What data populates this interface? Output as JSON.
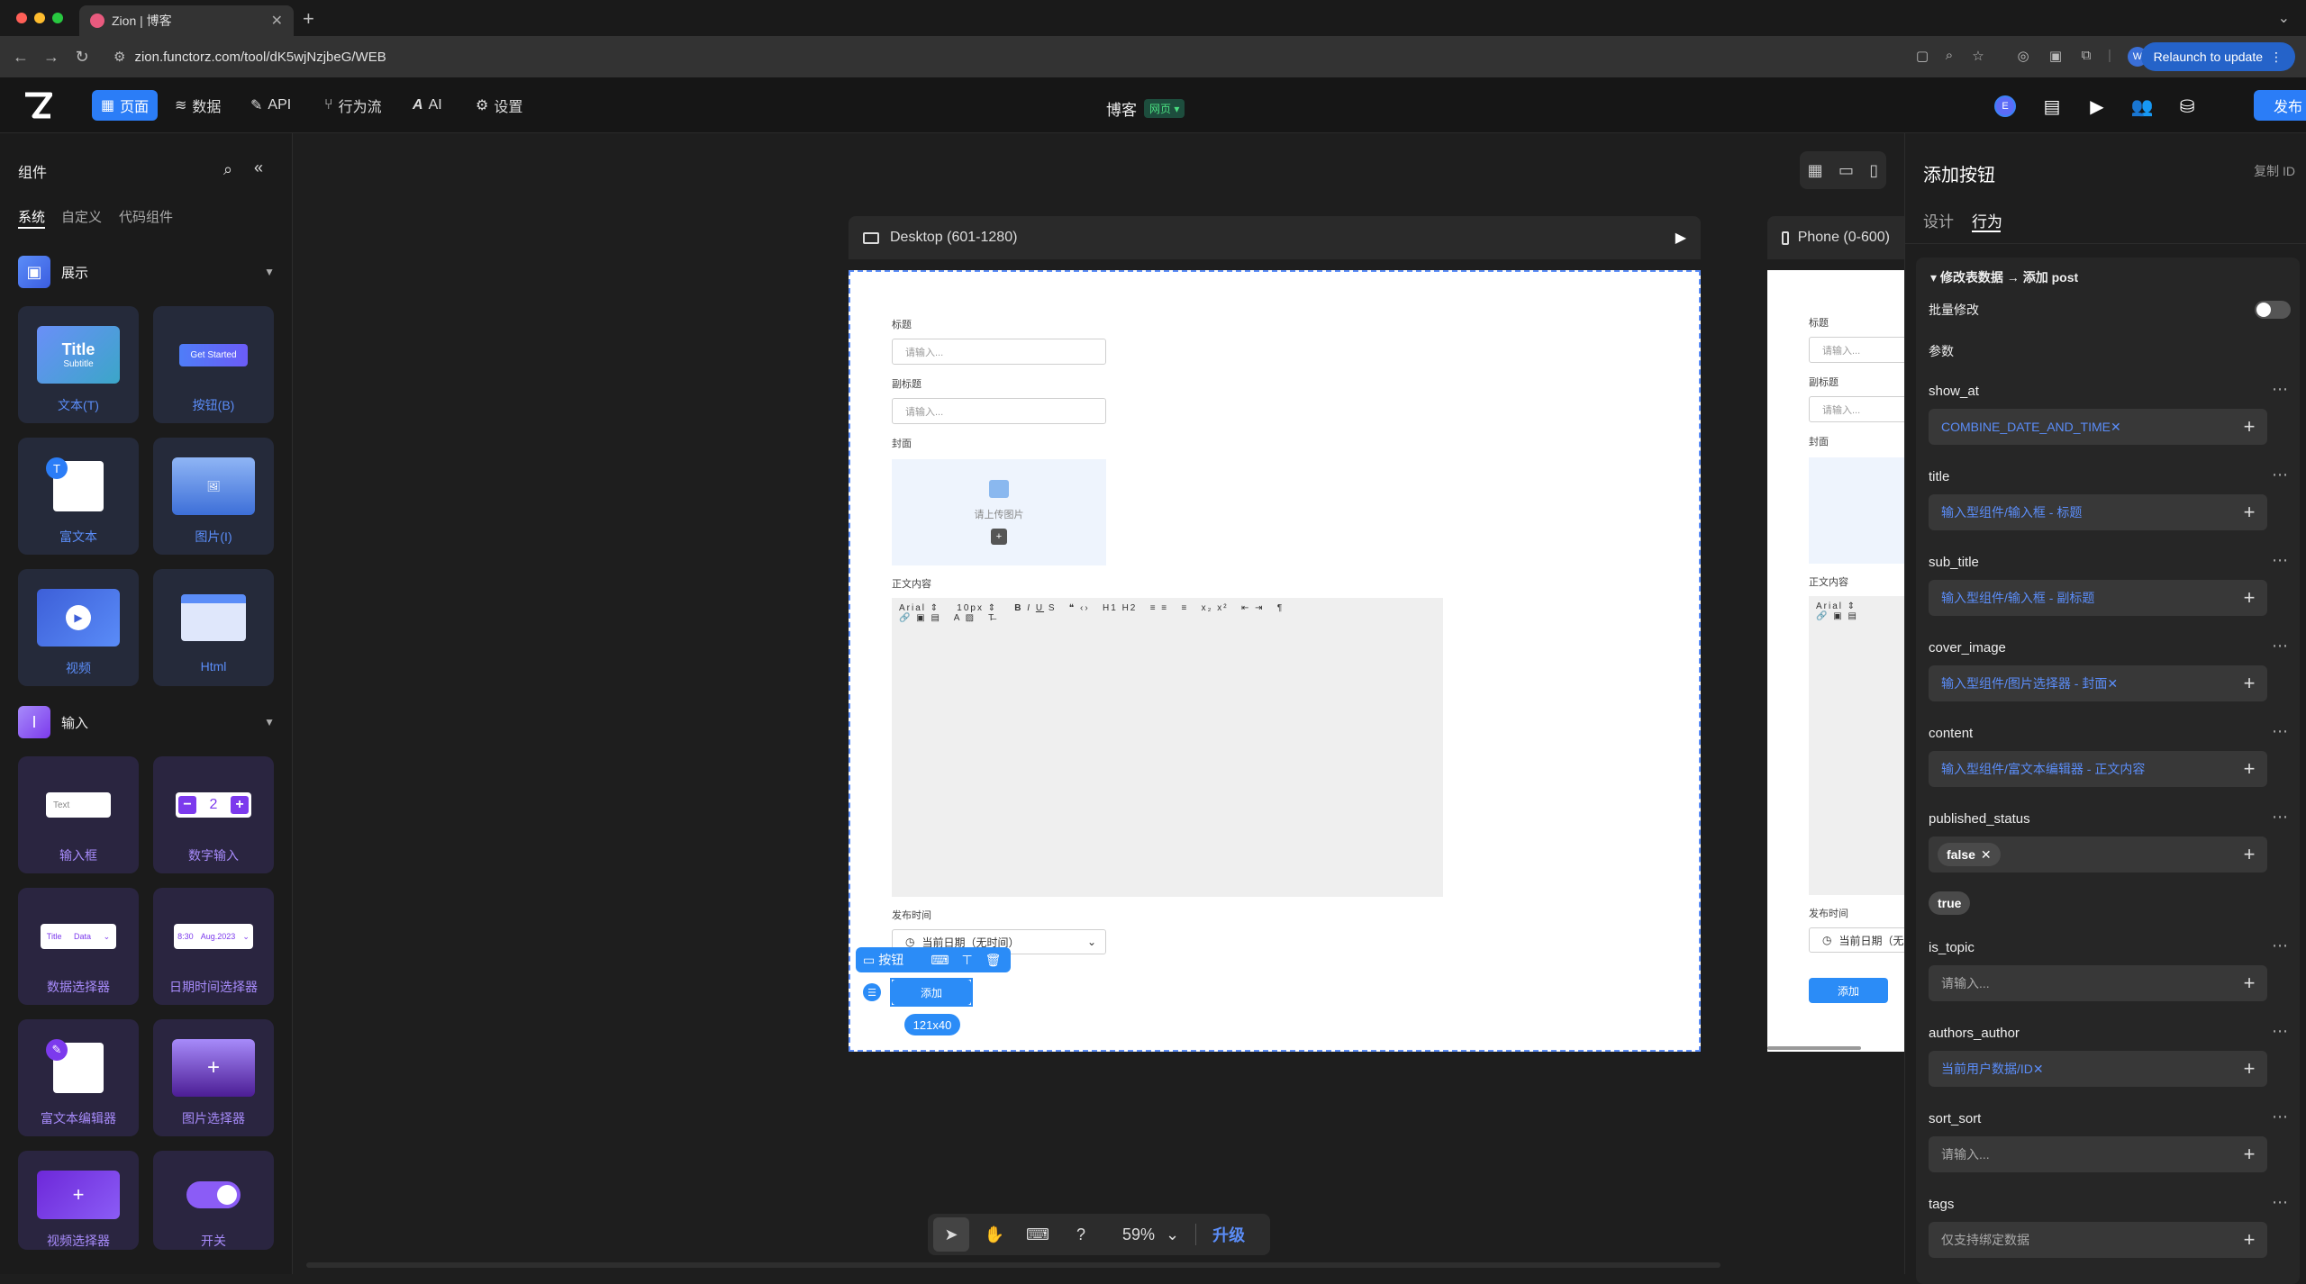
{
  "browser": {
    "tab_title": "Zion | 博客",
    "url": "zion.functorz.com/tool/dK5wjNzjbeG/WEB",
    "relaunch_label": "Relaunch to update",
    "profile_initial": "W"
  },
  "app_nav": {
    "items": [
      {
        "label": "页面",
        "icon": "page-icon"
      },
      {
        "label": "数据",
        "icon": "database-icon"
      },
      {
        "label": "API",
        "icon": "api-icon"
      },
      {
        "label": "行为流",
        "icon": "flow-icon"
      },
      {
        "label": "AI",
        "icon": "ai-icon"
      },
      {
        "label": "设置",
        "icon": "gear-icon"
      }
    ],
    "page_title": "博客",
    "page_tag": "网页",
    "publish_label": "发布",
    "avatar_badge": "E"
  },
  "left_panel": {
    "header": "组件",
    "tabs": [
      "系统",
      "自定义",
      "代码组件"
    ],
    "section_display": "展示",
    "section_input": "输入",
    "display_cards": [
      {
        "label": "文本(T)",
        "thumb_title": "Title",
        "thumb_sub": "Subtitle"
      },
      {
        "label": "按钮(B)",
        "thumb_title": "Get Started"
      },
      {
        "label": "富文本"
      },
      {
        "label": "图片(I)"
      },
      {
        "label": "视频"
      },
      {
        "label": "Html"
      }
    ],
    "input_cards": [
      {
        "label": "输入框",
        "thumb_title": "Text"
      },
      {
        "label": "数字输入",
        "thumb_title": "2"
      },
      {
        "label": "数据选择器",
        "thumb_title": "Title",
        "thumb_sub": "Data"
      },
      {
        "label": "日期时间选择器",
        "thumb_title": "8:30",
        "thumb_sub": "Aug.2023"
      },
      {
        "label": "富文本编辑器"
      },
      {
        "label": "图片选择器"
      },
      {
        "label": "视频选择器"
      },
      {
        "label": "开关"
      }
    ]
  },
  "canvas": {
    "desktop_label": "Desktop (601-1280)",
    "phone_label": "Phone (0-600)",
    "form": {
      "title_label": "标题",
      "title_placeholder": "请输入...",
      "subtitle_label": "副标题",
      "subtitle_placeholder": "请输入...",
      "cover_label": "封面",
      "upload_text": "请上传图片",
      "content_label": "正文内容",
      "rte_font": "Arial",
      "rte_size": "10px",
      "publish_time_label": "发布时间",
      "date_value": "当前日期（无时间）",
      "add_button": "添加"
    },
    "selection": {
      "tool_label": "按钮",
      "size": "121x40"
    },
    "bottom_bar": {
      "zoom": "59%",
      "upgrade": "升级"
    }
  },
  "right_panel": {
    "title": "添加按钮",
    "copy_id": "复制 ID",
    "tabs": [
      "设计",
      "行为"
    ],
    "action_header": "修改表数据 → 添加 post",
    "batch_label": "批量修改",
    "params_label": "参数",
    "params": [
      {
        "name": "show_at",
        "value": "COMBINE_DATE_AND_TIME",
        "removable": true
      },
      {
        "name": "title",
        "value": "输入型组件/输入框 - 标题"
      },
      {
        "name": "sub_title",
        "value": "输入型组件/输入框 - 副标题"
      },
      {
        "name": "cover_image",
        "value": "输入型组件/图片选择器 - 封面",
        "removable": true
      },
      {
        "name": "content",
        "value": "输入型组件/富文本编辑器 - 正文内容"
      },
      {
        "name": "published_status",
        "chip": "false",
        "option": "true"
      },
      {
        "name": "is_topic",
        "placeholder": "请输入..."
      },
      {
        "name": "authors_author",
        "value": "当前用户数据/ID",
        "removable": true
      },
      {
        "name": "sort_sort",
        "placeholder": "请输入..."
      },
      {
        "name": "tags",
        "placeholder": "仅支持绑定数据"
      }
    ]
  }
}
